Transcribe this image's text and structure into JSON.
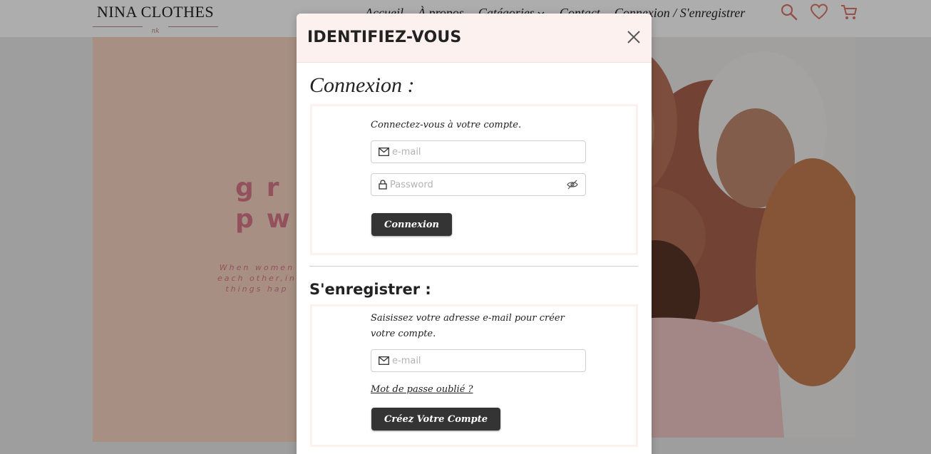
{
  "header": {
    "logo": "NINA CLOTHES",
    "logo_sub": "nk",
    "nav": [
      {
        "label": "Accueil"
      },
      {
        "label": "À propos"
      },
      {
        "label": "Catégories"
      },
      {
        "label": "Contact"
      },
      {
        "label": "Connexion / S'enregistrer"
      }
    ],
    "icons": [
      "search-icon",
      "heart-icon",
      "cart-icon"
    ],
    "accent": "#d9786a"
  },
  "hero": {
    "big_lines": [
      "gr",
      "pw"
    ],
    "small_lines": [
      "When women",
      "each other,in",
      "things hap"
    ]
  },
  "modal": {
    "title": "IDENTIFIEZ-VOUS",
    "login": {
      "heading": "Connexion :",
      "intro": "Connectez-vous à votre compte.",
      "email_placeholder": "e-mail",
      "password_placeholder": "Password",
      "button": "Connexion"
    },
    "register": {
      "heading": "S'enregistrer :",
      "intro": "Saisissez votre adresse e-mail pour créer votre compte.",
      "email_placeholder": "e-mail",
      "forgot_link": "Mot de passe oublié ?",
      "button": "Créez Votre Compte"
    }
  },
  "colors": {
    "modal_header_bg": "#fdf1ef",
    "button_bg": "#343434",
    "hero_bg": "#f7d5c2",
    "hero_text": "#d9788a"
  }
}
